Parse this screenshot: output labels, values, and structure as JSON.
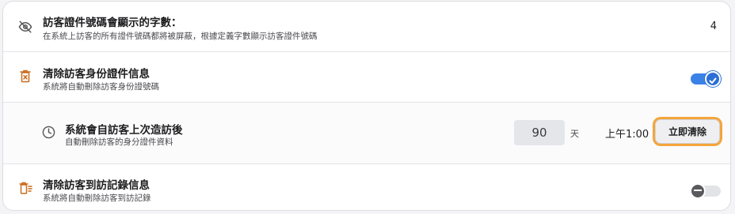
{
  "rows": {
    "visitor_id_digits": {
      "title": "訪客證件號碼會顯示的字數：",
      "description": "在系統上訪客的所有證件號碼都將被屏蔽，根據定義字數顯示訪客證件號碼",
      "value": "4",
      "icon": "eye-off-icon"
    },
    "clear_id_info": {
      "title": "清除訪客身份證件信息",
      "description": "系統將自動刪除訪客身份證號碼",
      "enabled": true,
      "icon": "trash-x-icon"
    },
    "auto_clear_after_visit": {
      "title": "系統會自訪客上次造訪後",
      "description": "自動刪除訪客的身分證件資料",
      "days_value": "90",
      "days_unit": "天",
      "time": "上午1:00",
      "clear_now_label": "立即清除",
      "icon": "clock-icon"
    },
    "clear_visit_records": {
      "title": "清除訪客到訪記錄信息",
      "description": "系統將自動刪除訪客到訪記錄",
      "enabled": false,
      "icon": "trash-list-icon"
    }
  },
  "colors": {
    "icon_orange": "#c96b1f",
    "toggle_on": "#3b82e6",
    "focus_ring": "#f4a53a"
  }
}
